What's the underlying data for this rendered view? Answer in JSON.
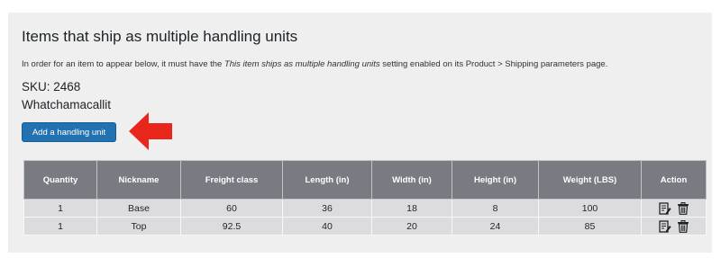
{
  "page": {
    "title": "Items that ship as multiple handling units",
    "description": {
      "prefix": "In order for an item to appear below, it must have the ",
      "setting": "This item ships as multiple handling units",
      "suffix": " setting enabled on its Product > Shipping parameters page."
    },
    "sku": "SKU: 2468",
    "product_name": "Whatchamacallit",
    "add_button_label": "Add a handling unit"
  },
  "table": {
    "headers": [
      "Quantity",
      "Nickname",
      "Freight class",
      "Length (in)",
      "Width (in)",
      "Height (in)",
      "Weight (LBS)",
      "Action"
    ],
    "rows": [
      {
        "quantity": "1",
        "nickname": "Base",
        "freight_class": "60",
        "length": "36",
        "width": "18",
        "height": "8",
        "weight": "100",
        "actions": [
          "edit-icon",
          "trash-icon"
        ]
      },
      {
        "quantity": "1",
        "nickname": "Top",
        "freight_class": "92.5",
        "length": "40",
        "width": "20",
        "height": "24",
        "weight": "85",
        "actions": [
          "edit-icon",
          "trash-icon"
        ]
      }
    ]
  },
  "annotation": {
    "arrow_color": "#e8261c",
    "points_to": "add-handling-unit-button"
  },
  "colors": {
    "button": "#2271b1",
    "table_header": "#787c82",
    "table_row": "#dcdcde",
    "panel": "#efefef"
  }
}
